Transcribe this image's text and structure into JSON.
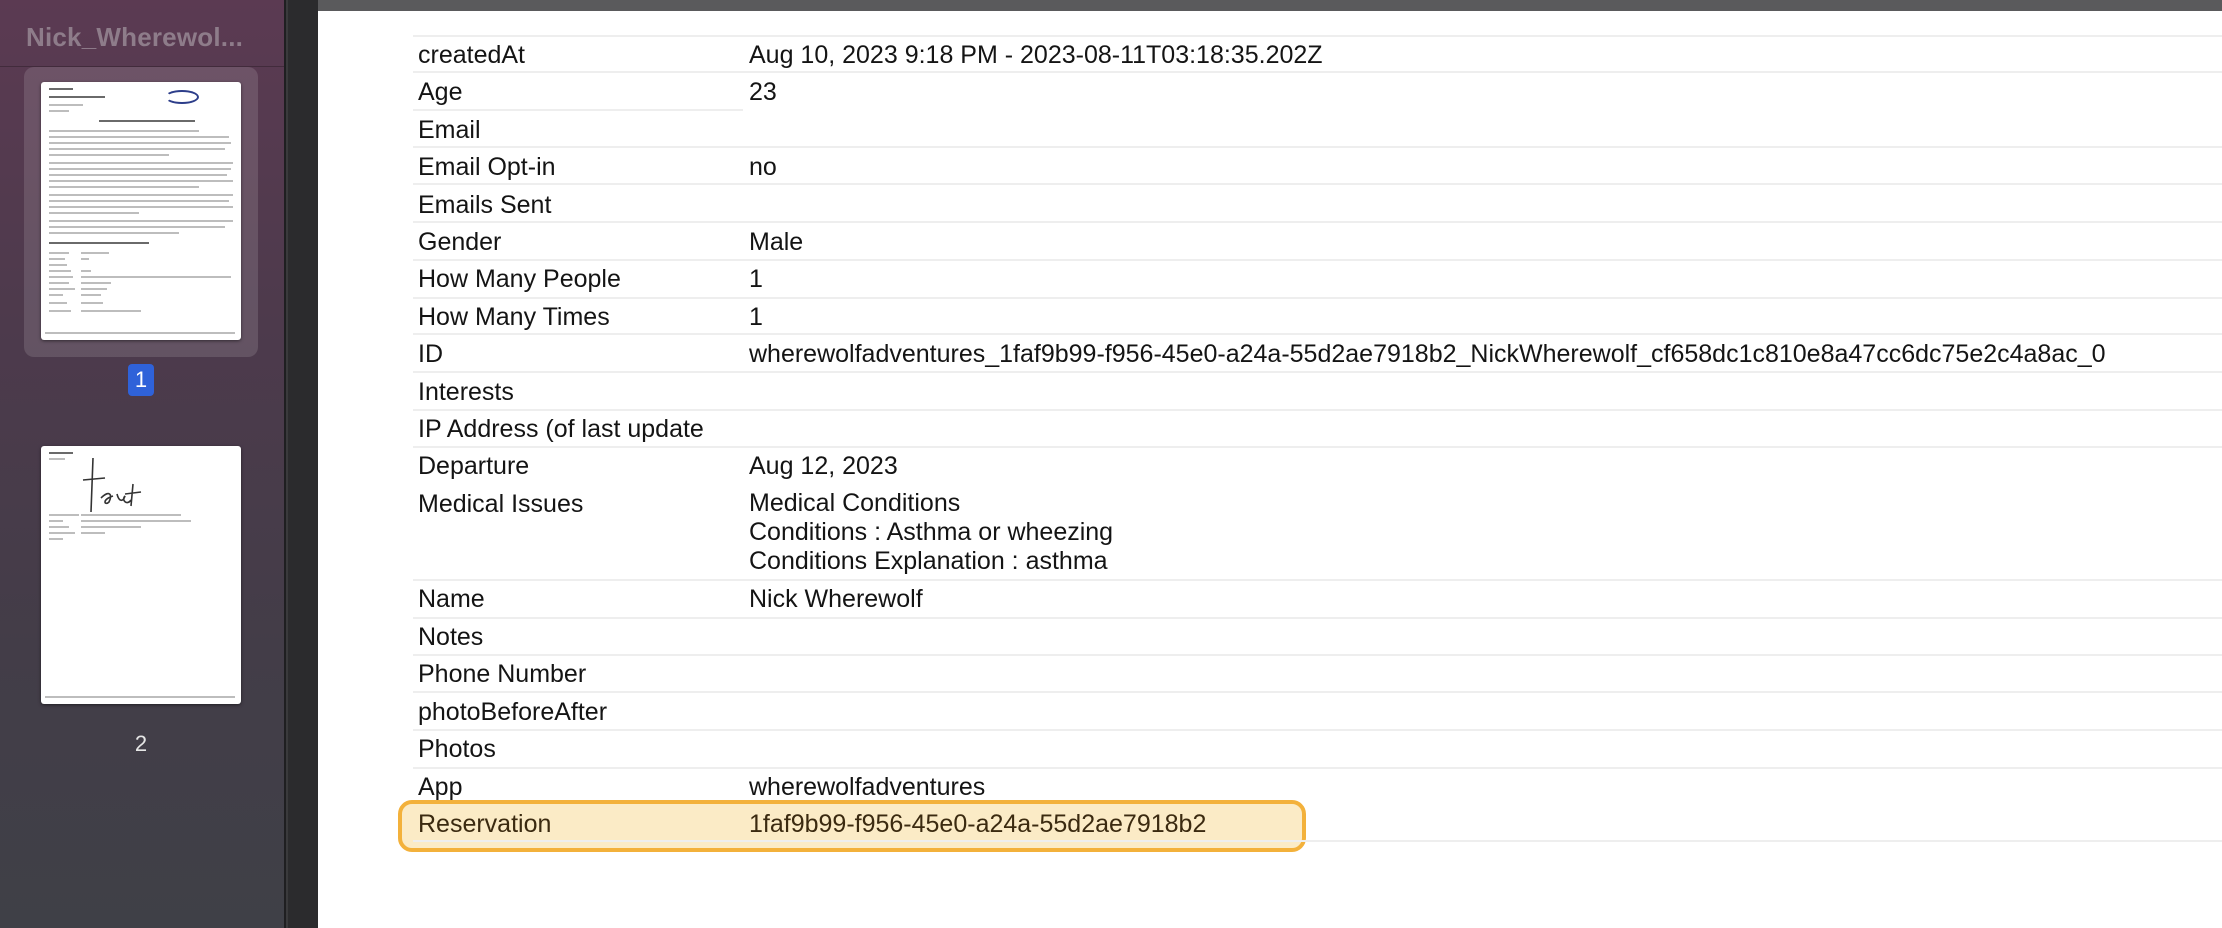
{
  "sidebar": {
    "document_title": "Nick_Wherewol...",
    "pages": [
      {
        "number": "1",
        "selected": true
      },
      {
        "number": "2",
        "selected": false
      }
    ]
  },
  "table": {
    "rows": [
      {
        "label": "createdAt",
        "value": "Aug 10, 2023 9:18 PM - 2023-08-11T03:18:35.202Z"
      },
      {
        "label": "Age",
        "value": "23"
      },
      {
        "label": "Email",
        "value": ""
      },
      {
        "label": "Email Opt-in",
        "value": "no"
      },
      {
        "label": "Emails Sent",
        "value": ""
      },
      {
        "label": "Gender",
        "value": "Male"
      },
      {
        "label": "How Many People",
        "value": "1"
      },
      {
        "label": "How Many Times",
        "value": "1"
      },
      {
        "label": "ID",
        "value": "wherewolfadventures_1faf9b99-f956-45e0-a24a-55d2ae7918b2_NickWherewolf_cf658dc1c810e8a47cc6dc75e2c4a8ac_0"
      },
      {
        "label": "Interests",
        "value": ""
      },
      {
        "label": "IP Address (of last update",
        "value": ""
      },
      {
        "label": "Departure",
        "value": "Aug 12, 2023"
      },
      {
        "label": "Medical Issues",
        "value_lines": [
          "Medical Conditions",
          "Conditions : Asthma or wheezing",
          "Conditions Explanation : asthma"
        ]
      },
      {
        "label": "Name",
        "value": "Nick Wherewolf"
      },
      {
        "label": "Notes",
        "value": ""
      },
      {
        "label": "Phone Number",
        "value": ""
      },
      {
        "label": "photoBeforeAfter",
        "value": ""
      },
      {
        "label": "Photos",
        "value": ""
      },
      {
        "label": "App",
        "value": "wherewolfadventures"
      },
      {
        "label": "Reservation",
        "value": "1faf9b99-f956-45e0-a24a-55d2ae7918b2",
        "highlighted": true
      }
    ]
  },
  "colors": {
    "highlight_fill": "#fbebc6",
    "highlight_border": "#f3b13b",
    "selected_page_badge": "#2f62d9"
  }
}
